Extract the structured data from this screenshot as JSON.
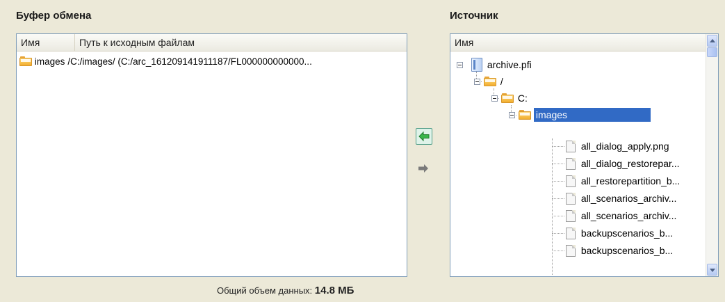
{
  "clipboard": {
    "title": "Буфер обмена",
    "columns": {
      "name": "Имя",
      "path": "Путь к исходным файлам"
    },
    "rows": [
      {
        "name": "images",
        "path": "/C:/images/ (C:/arc_161209141911187/FL000000000000..."
      }
    ]
  },
  "source": {
    "title": "Источник",
    "column": "Имя",
    "tree": {
      "archive": "archive.pfi",
      "root": "/",
      "drive": "C:",
      "folder": "images",
      "files": [
        "all_dialog_apply.png",
        "all_dialog_restorepar...",
        "all_restorepartition_b...",
        "all_scenarios_archiv...",
        "all_scenarios_archiv...",
        "backupscenarios_b...",
        "backupscenarios_b..."
      ]
    }
  },
  "total": {
    "label": "Общий объем данных:",
    "value": "14.8 МБ"
  },
  "colors": {
    "accent": "#316ac5",
    "panel_border": "#7f9db9",
    "background": "#ece9d8"
  },
  "icons": {
    "add": "green-left-arrow-icon",
    "remove": "gray-right-arrow-icon",
    "folder": "folder-icon",
    "file": "file-icon",
    "archive": "archive-file-icon"
  }
}
